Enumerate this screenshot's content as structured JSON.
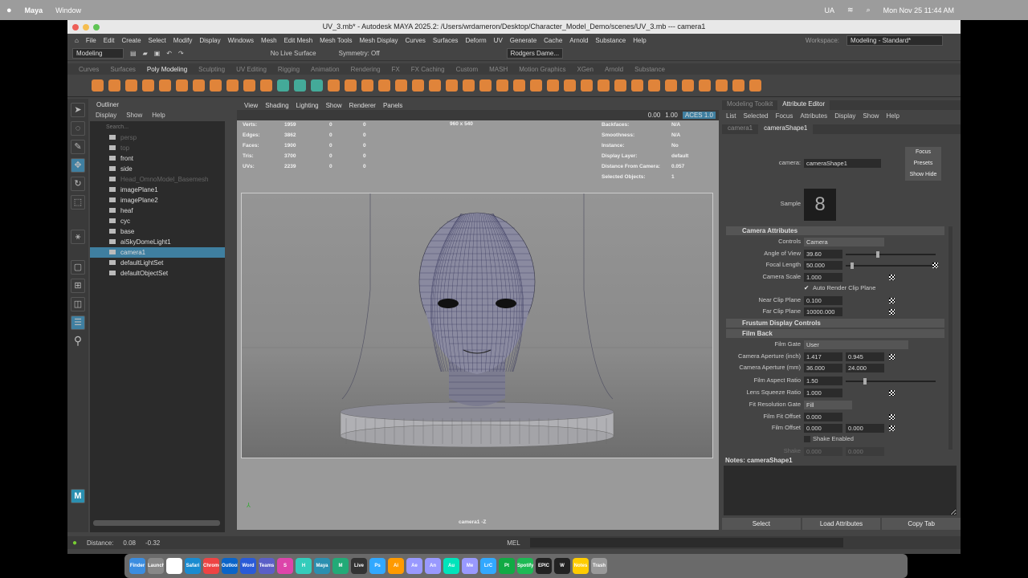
{
  "macbar": {
    "apple": "",
    "app": "Maya",
    "menu": "Window",
    "clock": "Mon Nov 25  11:44 AM",
    "ua": "UA"
  },
  "window": {
    "title": "UV_3.mb* - Autodesk MAYA 2025.2: /Users/wrdameron/Desktop/Character_Model_Demo/scenes/UV_3.mb  ---  camera1"
  },
  "menus": [
    "File",
    "Edit",
    "Create",
    "Select",
    "Modify",
    "Display",
    "Windows",
    "Mesh",
    "Edit Mesh",
    "Mesh Tools",
    "Mesh Display",
    "Curves",
    "Surfaces",
    "Deform",
    "UV",
    "Generate",
    "Cache",
    "Arnold",
    "Substance",
    "Help"
  ],
  "workspace": {
    "label": "Workspace:",
    "value": "Modeling - Standard*"
  },
  "status": {
    "mode": "Modeling",
    "live": "No Live Surface",
    "symmetry": "Symmetry: Off",
    "user": "Rodgers Dame..."
  },
  "shelf_tabs": [
    "Curves",
    "Surfaces",
    "Poly Modeling",
    "Sculpting",
    "UV Editing",
    "Rigging",
    "Animation",
    "Rendering",
    "FX",
    "FX Caching",
    "Custom",
    "MASH",
    "Motion Graphics",
    "XGen",
    "Arnold",
    "Substance"
  ],
  "outliner": {
    "title": "Outliner",
    "menu": [
      "Display",
      "Show",
      "Help"
    ],
    "search": "Search...",
    "items": [
      {
        "l": "persp",
        "d": true
      },
      {
        "l": "top",
        "d": true
      },
      {
        "l": "front"
      },
      {
        "l": "side"
      },
      {
        "l": "Head_OmnoModel_Basemesh",
        "d": true
      },
      {
        "l": "imagePlane1"
      },
      {
        "l": "imagePlane2"
      },
      {
        "l": "heaf"
      },
      {
        "l": "cyc"
      },
      {
        "l": "base"
      },
      {
        "l": "aiSkyDomeLight1"
      },
      {
        "l": "camera1",
        "s": true
      },
      {
        "l": "defaultLightSet"
      },
      {
        "l": "defaultObjectSet"
      }
    ]
  },
  "viewport": {
    "menu": [
      "View",
      "Shading",
      "Lighting",
      "Show",
      "Renderer",
      "Panels"
    ],
    "exposure": "0.00",
    "gamma": "1.00",
    "colorspace": "ACES 1.0",
    "resolution": "960 x 540",
    "camera_label": "camera1 -Z",
    "stats": [
      [
        "Verts:",
        "1959",
        "0",
        "0"
      ],
      [
        "Edges:",
        "3862",
        "0",
        "0"
      ],
      [
        "Faces:",
        "1900",
        "0",
        "0"
      ],
      [
        "Tris:",
        "3700",
        "0",
        "0"
      ],
      [
        "UVs:",
        "2239",
        "0",
        "0"
      ]
    ],
    "info": [
      [
        "Backfaces:",
        "N/A"
      ],
      [
        "Smoothness:",
        "N/A"
      ],
      [
        "Instance:",
        "No"
      ],
      [
        "Display Layer:",
        "default"
      ],
      [
        "Distance From Camera:",
        "0.057"
      ],
      [
        "Selected Objects:",
        "1"
      ]
    ]
  },
  "ae": {
    "tabs": [
      "Modeling Toolkit",
      "Attribute Editor"
    ],
    "menu": [
      "List",
      "Selected",
      "Focus",
      "Attributes",
      "Display",
      "Show",
      "Help"
    ],
    "node_tabs": [
      "camera1",
      "cameraShape1"
    ],
    "camera_label": "camera:",
    "camera_value": "cameraShape1",
    "focus": "Focus",
    "presets": "Presets",
    "show": "Show",
    "hide": "Hide",
    "sample": "Sample",
    "sections": {
      "cam": "Camera Attributes",
      "frustum": "Frustum Display Controls",
      "film": "Film Back"
    },
    "controls": "Controls",
    "controls_v": "Camera",
    "aov": "Angle of View",
    "aov_v": "39.60",
    "fl": "Focal Length",
    "fl_v": "50.000",
    "cs": "Camera Scale",
    "cs_v": "1.000",
    "arcp": "Auto Render Clip Plane",
    "ncp": "Near Clip Plane",
    "ncp_v": "0.100",
    "fcp": "Far Clip Plane",
    "fcp_v": "10000.000",
    "fg": "Film Gate",
    "fg_v": "User",
    "cai": "Camera Aperture (inch)",
    "cai_1": "1.417",
    "cai_2": "0.945",
    "cam": "Camera Aperture (mm)",
    "cam_1": "36.000",
    "cam_2": "24.000",
    "far": "Film Aspect Ratio",
    "far_v": "1.50",
    "lsr": "Lens Squeeze Ratio",
    "lsr_v": "1.000",
    "frg": "Fit Resolution Gate",
    "frg_v": "Fill",
    "ffo": "Film Fit Offset",
    "ffo_v": "0.000",
    "fo": "Film Offset",
    "fo_1": "0.000",
    "fo_2": "0.000",
    "se": "Shake Enabled",
    "shake": "Shake",
    "shake_1": "0.000",
    "shake_2": "0.000",
    "notes": "Notes:  cameraShape1",
    "buttons": [
      "Select",
      "Load Attributes",
      "Copy Tab"
    ]
  },
  "helpline": {
    "label": "Distance:",
    "v1": "0.08",
    "v2": "-0.32",
    "mel": "MEL"
  },
  "dock": [
    "Finder",
    "Launchpad",
    "Calendar 25",
    "Safari",
    "Chrome",
    "Outlook",
    "Word",
    "Teams",
    "S",
    "H",
    "Maya",
    "M",
    "Live",
    "Ps",
    "Ai",
    "Ae",
    "An",
    "Au",
    "Me",
    "LrC",
    "Pt",
    "Spotify",
    "EPIC",
    "W",
    "Notes",
    "Trash"
  ]
}
